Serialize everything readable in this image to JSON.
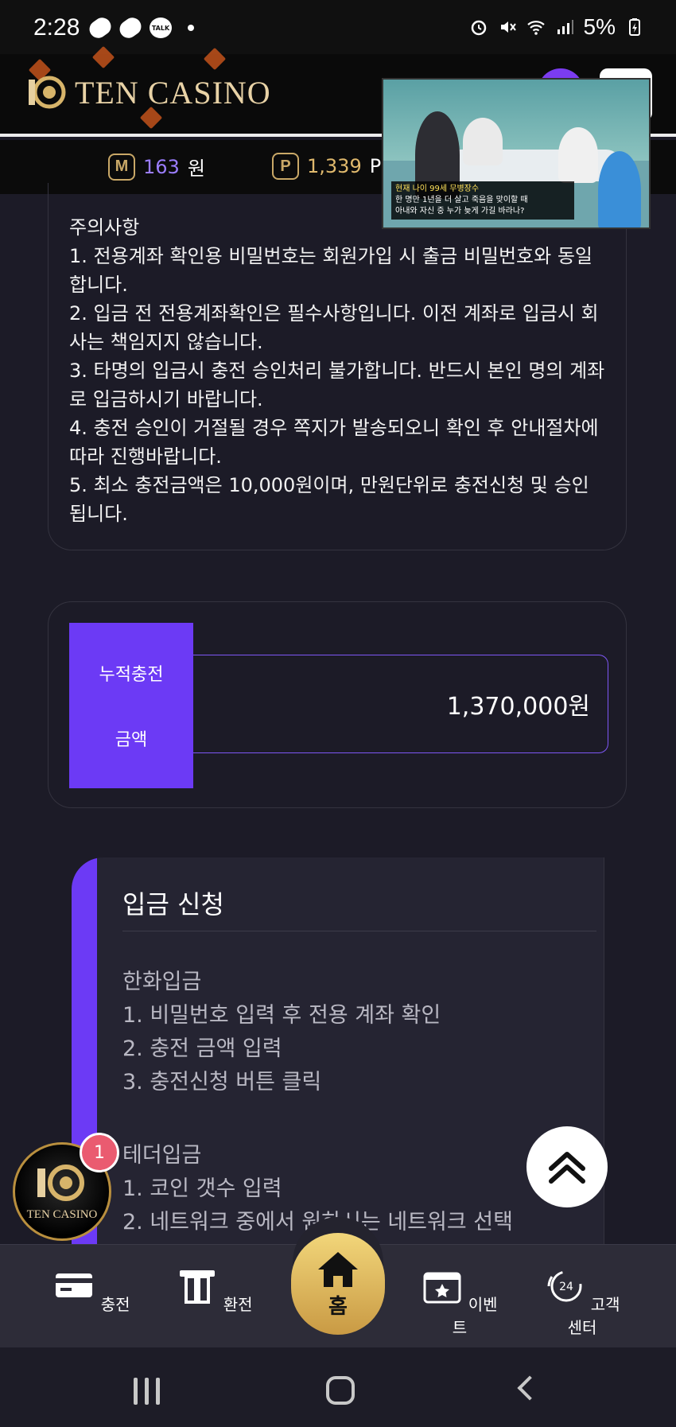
{
  "status_bar": {
    "time": "2:28",
    "talk_icon_label": "TALK",
    "battery": "5%",
    "icons": [
      "pill-icon",
      "pill-icon",
      "talk-icon",
      "dot-icon",
      "alarm-icon",
      "mute-icon",
      "wifi-icon",
      "signal-icon",
      "battery-charging-icon"
    ]
  },
  "header": {
    "logo_text": "TEN CASINO"
  },
  "points": {
    "money_badge": "M",
    "money_value": "163",
    "money_unit": "원",
    "point_badge": "P",
    "point_value": "1,339",
    "point_unit": "P"
  },
  "video": {
    "caption_top": "현재 나이 99세 무병장수",
    "caption_line1": "한 명만 1년을 더 살고 죽음을 맞이할 때",
    "caption_line2": "아내와 자신 중 누가 늦게 가길 바라나?"
  },
  "notice": {
    "title": "주의사항",
    "items": [
      "1. 전용계좌 확인용 비밀번호는 회원가입 시 출금 비밀번호와 동일합니다.",
      "2. 입금 전 전용계좌확인은 필수사항입니다. 이전 계좌로 입금시 회사는 책임지지 않습니다.",
      "3. 타명의 입금시 충전 승인처리 불가합니다. 반드시 본인 명의 계좌로 입금하시기 바랍니다.",
      "4. 충전 승인이 거절될 경우 쪽지가 발송되오니 확인 후 안내절차에 따라 진행바랍니다.",
      "5. 최소 충전금액은 10,000원이며, 만원단위로 충전신청 및 승인됩니다."
    ]
  },
  "accumulated": {
    "label_line1": "누적충전",
    "label_line2": "금액",
    "value": "1,370,000원"
  },
  "deposit_request": {
    "title": "입금 신청",
    "hanwha_title": "한화입금",
    "hanwha_steps": [
      "1. 비밀번호 입력 후 전용 계좌 확인",
      "2. 충전 금액 입력",
      "3. 충전신청 버튼 클릭"
    ],
    "tether_title": "테더입금",
    "tether_steps": [
      "1. 코인 갯수 입력",
      "2. 네트워크 중에서 원하시는 네트워크 선택"
    ]
  },
  "floating": {
    "logo_text": "TEN CASINO",
    "badge_count": "1"
  },
  "bottom_nav": {
    "charge": "충전",
    "exchange": "환전",
    "home": "홈",
    "event": "이벤트",
    "support": "고객센터",
    "support_icon_text": "24"
  },
  "colors": {
    "accent": "#6c3af5",
    "gold": "#c9a867",
    "background": "#1c1b27"
  }
}
